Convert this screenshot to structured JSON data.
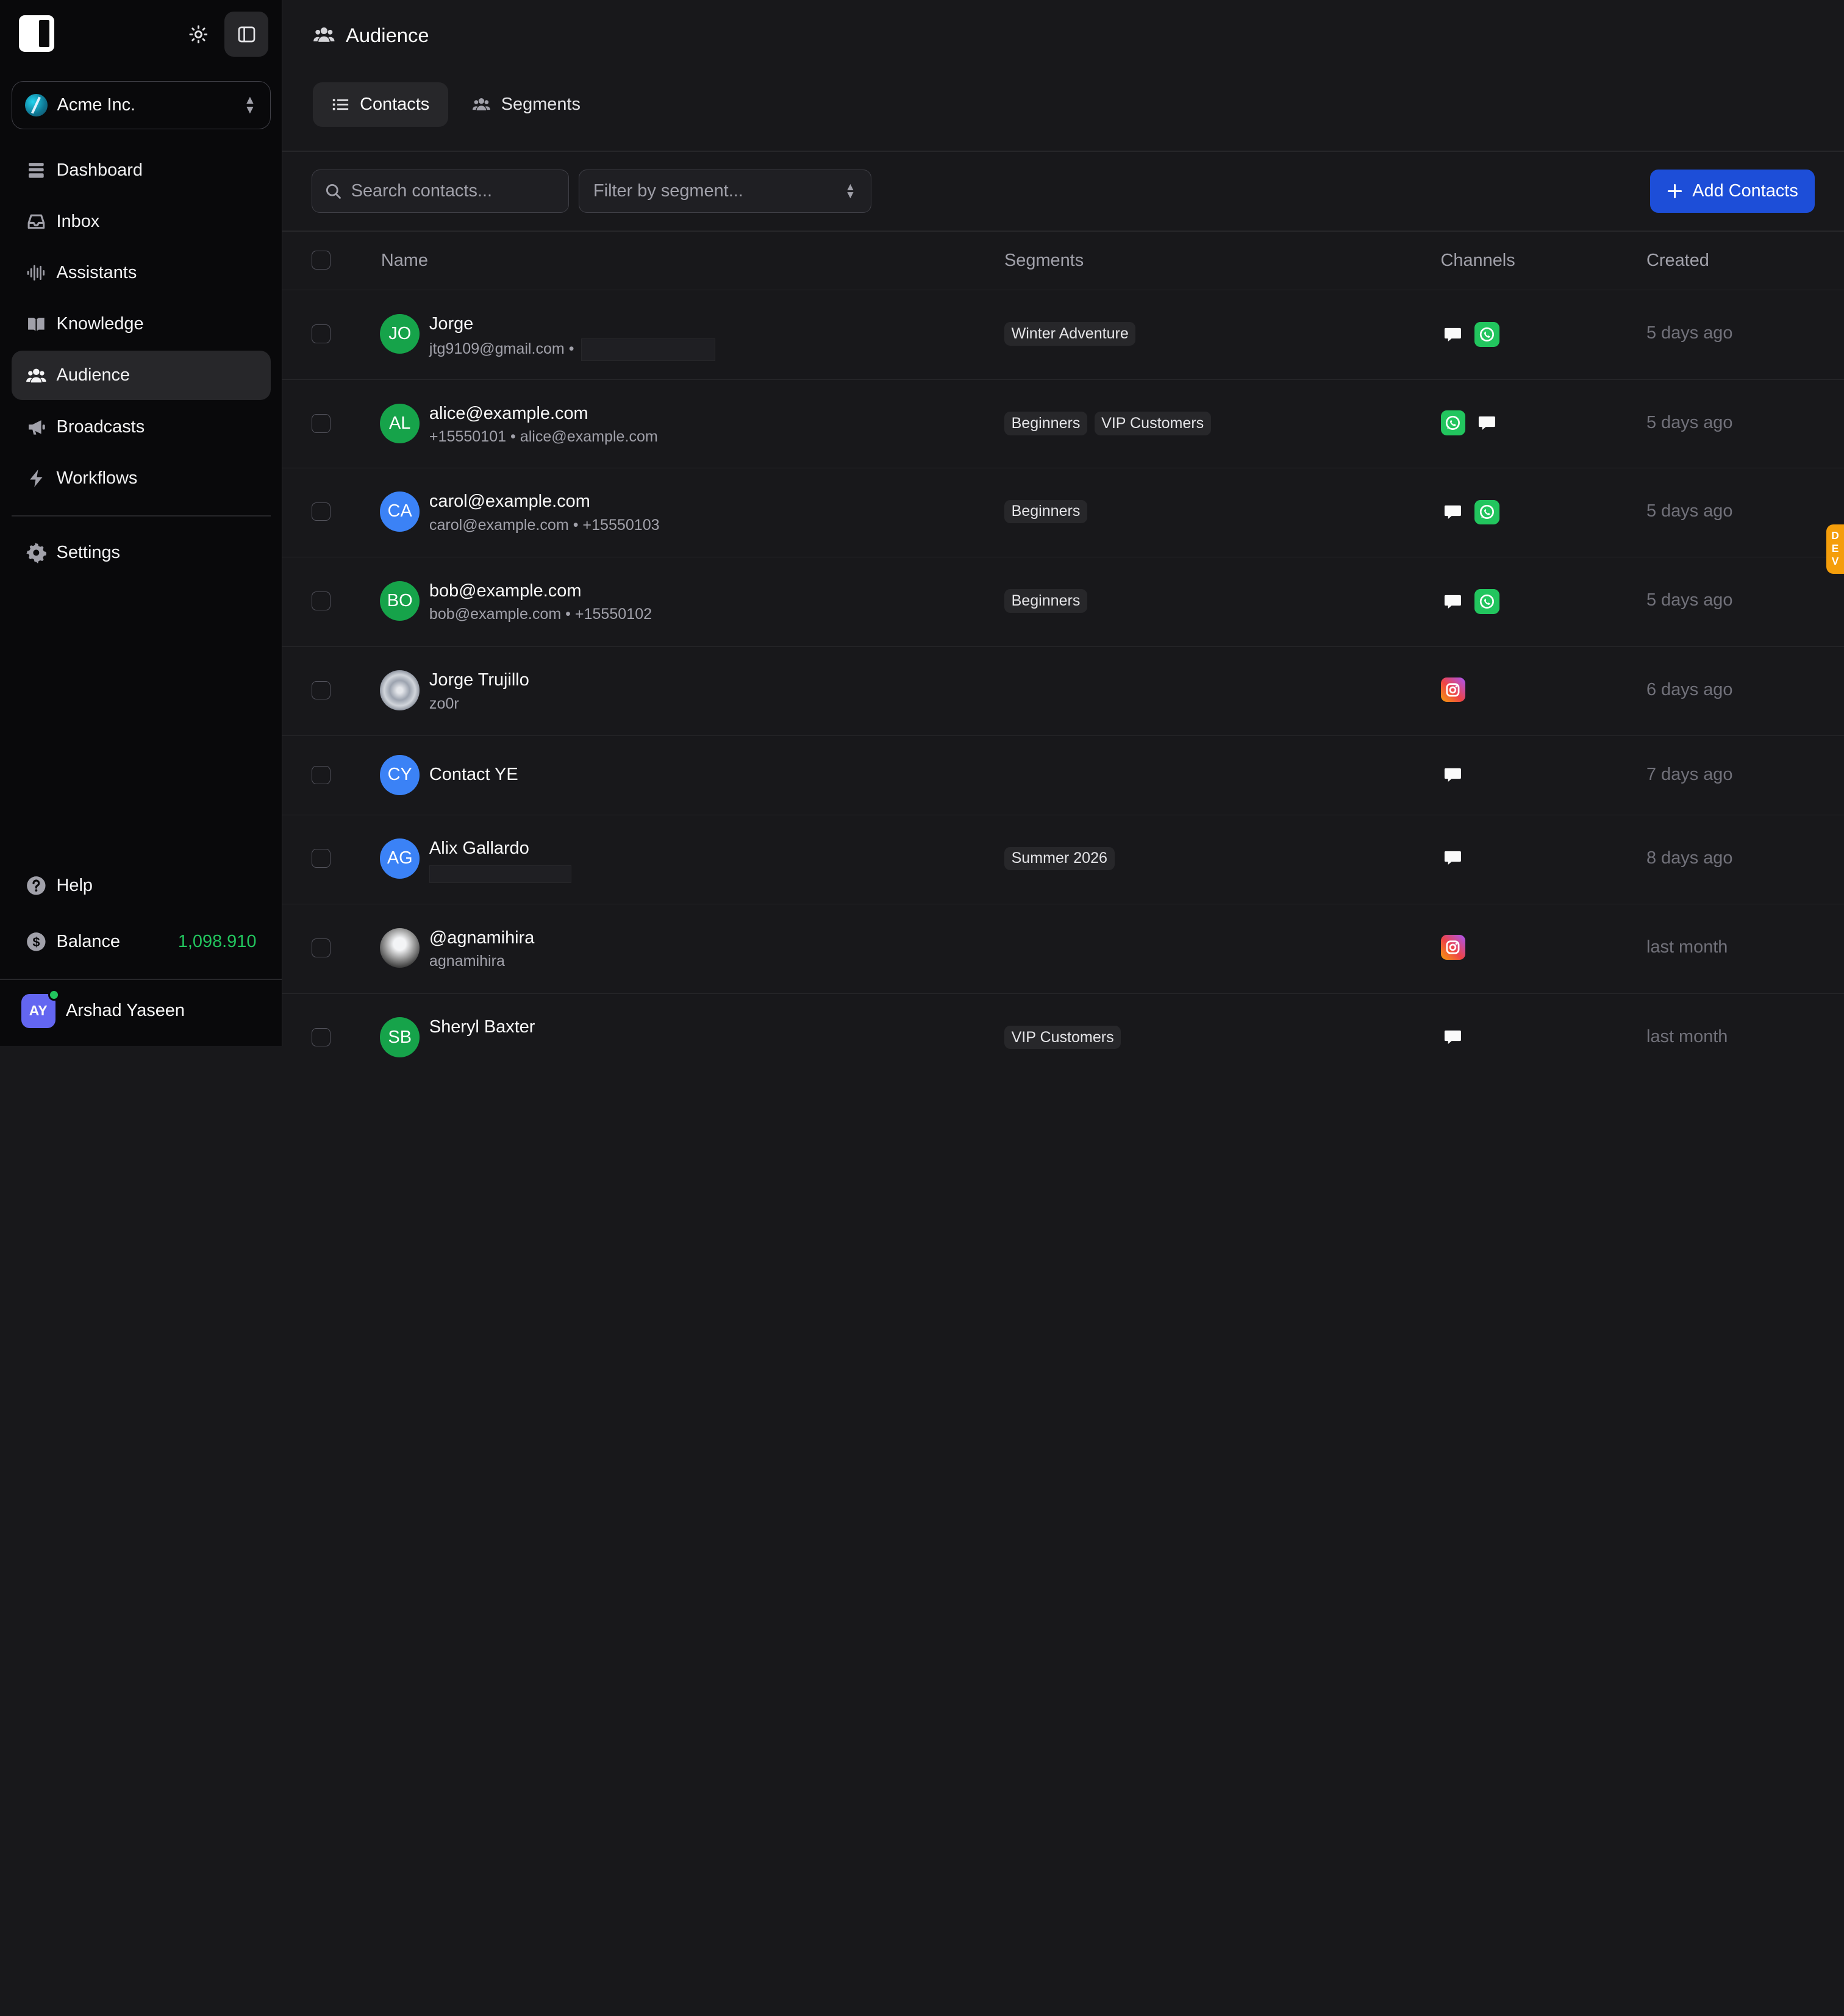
{
  "org": {
    "name": "Acme Inc."
  },
  "nav": {
    "items": [
      {
        "label": "Dashboard"
      },
      {
        "label": "Inbox"
      },
      {
        "label": "Assistants"
      },
      {
        "label": "Knowledge"
      },
      {
        "label": "Audience"
      },
      {
        "label": "Broadcasts"
      },
      {
        "label": "Workflows"
      }
    ],
    "settings": "Settings",
    "help": "Help"
  },
  "balance": {
    "label": "Balance",
    "value": "1,098.910"
  },
  "user": {
    "initials": "AY",
    "name": "Arshad Yaseen"
  },
  "page": {
    "title": "Audience"
  },
  "tabs": [
    {
      "label": "Contacts"
    },
    {
      "label": "Segments"
    }
  ],
  "toolbar": {
    "search_placeholder": "Search contacts...",
    "filter_placeholder": "Filter by segment...",
    "add_label": "Add Contacts"
  },
  "table": {
    "headers": {
      "name": "Name",
      "segments": "Segments",
      "channels": "Channels",
      "created": "Created"
    },
    "rows": [
      {
        "initials": "JO",
        "name": "Jorge",
        "sub": "jtg9109@gmail.com •",
        "segments": [
          "Winter Adventure"
        ],
        "created": "5 days ago"
      },
      {
        "initials": "AL",
        "name": "alice@example.com",
        "sub": "+15550101 • alice@example.com",
        "segments": [
          "Beginners",
          "VIP Customers"
        ],
        "created": "5 days ago"
      },
      {
        "initials": "CA",
        "name": "carol@example.com",
        "sub": "carol@example.com • +15550103",
        "segments": [
          "Beginners"
        ],
        "created": "5 days ago"
      },
      {
        "initials": "BO",
        "name": "bob@example.com",
        "sub": "bob@example.com • +15550102",
        "segments": [
          "Beginners"
        ],
        "created": "5 days ago"
      },
      {
        "initials": "",
        "name": "Jorge Trujillo",
        "sub": "zo0r",
        "segments": [],
        "created": "6 days ago"
      },
      {
        "initials": "CY",
        "name": "Contact YE",
        "sub": "",
        "segments": [],
        "created": "7 days ago"
      },
      {
        "initials": "AG",
        "name": "Alix Gallardo",
        "sub": "",
        "segments": [
          "Summer 2026"
        ],
        "created": "8 days ago"
      },
      {
        "initials": "",
        "name": "@agnamihira",
        "sub": "agnamihira",
        "segments": [],
        "created": "last month"
      },
      {
        "initials": "SB",
        "name": "Sheryl Baxter",
        "sub": "",
        "segments": [
          "VIP Customers"
        ],
        "created": "last month"
      }
    ]
  },
  "dev_badge": "DEV",
  "colors": {
    "accent": "#1d4ed8",
    "balance": "#22c55e",
    "whatsapp": "#22c55e"
  }
}
